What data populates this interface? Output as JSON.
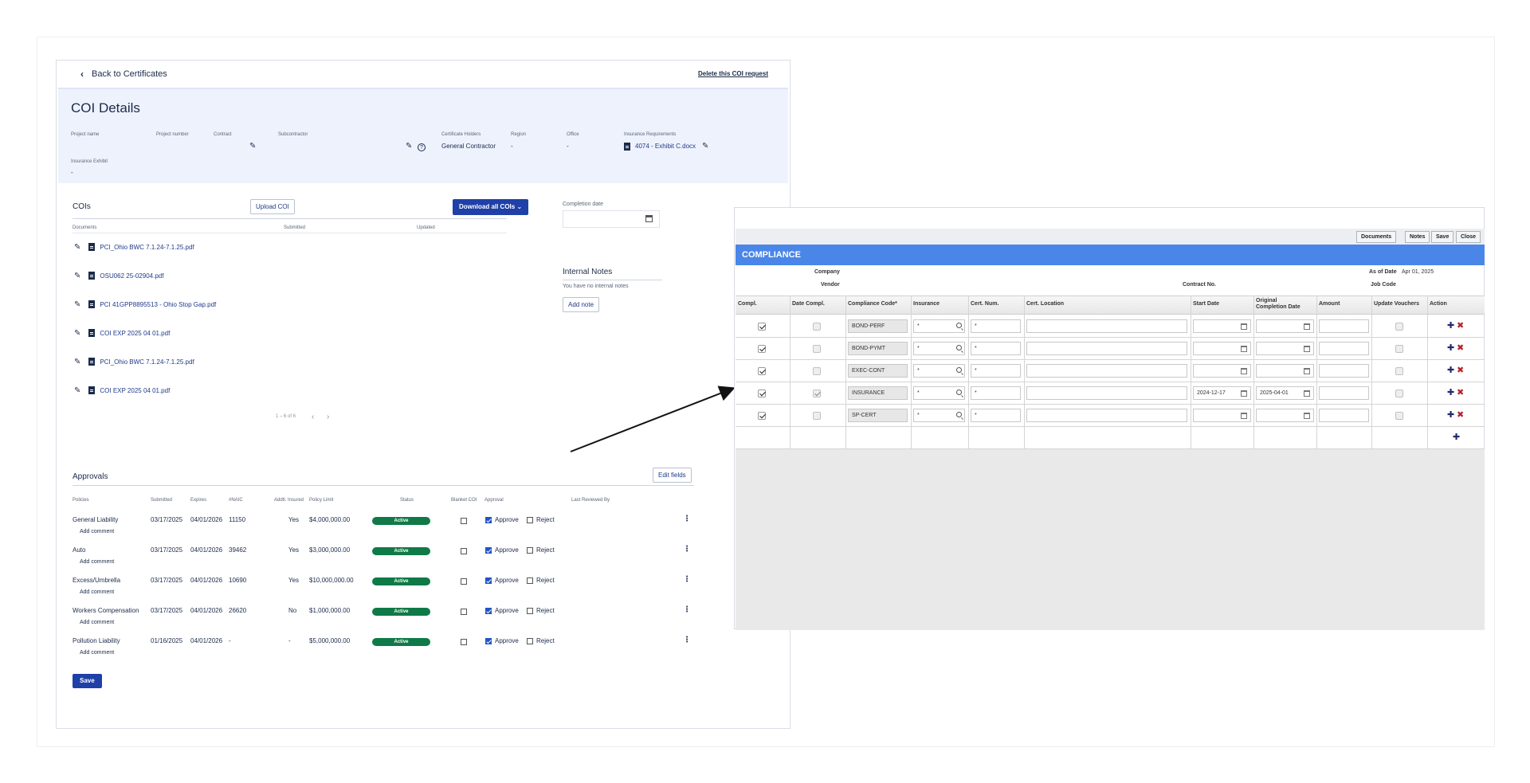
{
  "left": {
    "back_label": "Back to Certificates",
    "delete_label": "Delete this COI request",
    "title": "COI Details",
    "fields": {
      "project_name": "Project name",
      "project_number": "Project number",
      "contract": "Contract",
      "subcontractor": "Subcontractor",
      "certificate_holders": "Certificate Holders",
      "certificate_holders_value": "General Contractor",
      "region": "Region",
      "region_value": "-",
      "office": "Office",
      "office_value": "-",
      "insurance_requirements": "Insurance Requirements",
      "insurance_requirements_value": "4074 - Exhibit C.docx",
      "insurance_exhibit": "Insurance Exhibit",
      "insurance_exhibit_value": "-"
    },
    "cois": {
      "title": "COIs",
      "upload_label": "Upload COI",
      "download_label": "Download all COIs",
      "col_documents": "Documents",
      "col_submitted": "Submitted",
      "col_updated": "Updated",
      "files": [
        "PCI_Ohio BWC 7.1.24-7.1.25.pdf",
        "OSU062 25-02904.pdf",
        "PCI 41GPP8895513 - Ohio Stop Gap.pdf",
        "COI EXP 2025 04 01.pdf",
        "PCI_Ohio BWC 7.1.24-7.1.25.pdf",
        "COI EXP 2025 04 01.pdf"
      ],
      "pager": "1 – 6 of 6"
    },
    "completion_date_label": "Completion date",
    "notes": {
      "title": "Internal Notes",
      "empty": "You have no internal notes",
      "add_label": "Add note"
    },
    "approvals": {
      "title": "Approvals",
      "edit_label": "Edit fields",
      "headers": [
        "Policies",
        "Submitted",
        "Expires",
        "#NAIC",
        "Addtl. Insured",
        "Policy Limit",
        "Status",
        "Blanket COI",
        "Approval",
        "Last Reviewed By"
      ],
      "add_comment": "Add comment",
      "approve_label": "Approve",
      "reject_label": "Reject",
      "rows": [
        {
          "policy": "General Liability",
          "submitted": "03/17/2025",
          "expires": "04/01/2026",
          "naic": "11150",
          "addl": "Yes",
          "limit": "$4,000,000.00",
          "status": "Active"
        },
        {
          "policy": "Auto",
          "submitted": "03/17/2025",
          "expires": "04/01/2026",
          "naic": "39462",
          "addl": "Yes",
          "limit": "$3,000,000.00",
          "status": "Active"
        },
        {
          "policy": "Excess/Umbrella",
          "submitted": "03/17/2025",
          "expires": "04/01/2026",
          "naic": "10690",
          "addl": "Yes",
          "limit": "$10,000,000.00",
          "status": "Active"
        },
        {
          "policy": "Workers Compensation",
          "submitted": "03/17/2025",
          "expires": "04/01/2026",
          "naic": "26620",
          "addl": "No",
          "limit": "$1,000,000.00",
          "status": "Active"
        },
        {
          "policy": "Pollution Liability",
          "submitted": "01/16/2025",
          "expires": "04/01/2026",
          "naic": "-",
          "addl": "-",
          "limit": "$5,000,000.00",
          "status": "Active"
        }
      ],
      "save_label": "Save"
    }
  },
  "right": {
    "toolbar": [
      "Documents",
      "Notes",
      "Save",
      "Close"
    ],
    "header": "COMPLIANCE",
    "company_label": "Company",
    "vendor_label": "Vendor",
    "contract_no_label": "Contract No.",
    "as_of_date_label": "As of Date",
    "as_of_date_value": "Apr 01, 2025",
    "job_code_label": "Job Code",
    "headers": [
      "Compl.",
      "Date Compl.",
      "Compliance Code*",
      "Insurance",
      "Cert. Num.",
      "Cert. Location",
      "Start Date",
      "Original Completion Date",
      "Amount",
      "Update Vouchers",
      "Action"
    ],
    "rows": [
      {
        "code": "BOND-PERF",
        "insurance": "*",
        "cert_num": "*",
        "start": "",
        "orig": "",
        "date_compl": false
      },
      {
        "code": "BOND-PYMT",
        "insurance": "*",
        "cert_num": "*",
        "start": "",
        "orig": "",
        "date_compl": false
      },
      {
        "code": "EXEC-CONT",
        "insurance": "*",
        "cert_num": "*",
        "start": "",
        "orig": "",
        "date_compl": false
      },
      {
        "code": "INSURANCE",
        "insurance": "*",
        "cert_num": "*",
        "start": "2024-12-17",
        "orig": "2025-04-01",
        "date_compl": true
      },
      {
        "code": "SP-CERT",
        "insurance": "*",
        "cert_num": "*",
        "start": "",
        "orig": "",
        "date_compl": false
      }
    ],
    "colors": {
      "header_blue": "#4a86e8",
      "plus": "#1c2b6e",
      "cross": "#b3232b"
    }
  }
}
